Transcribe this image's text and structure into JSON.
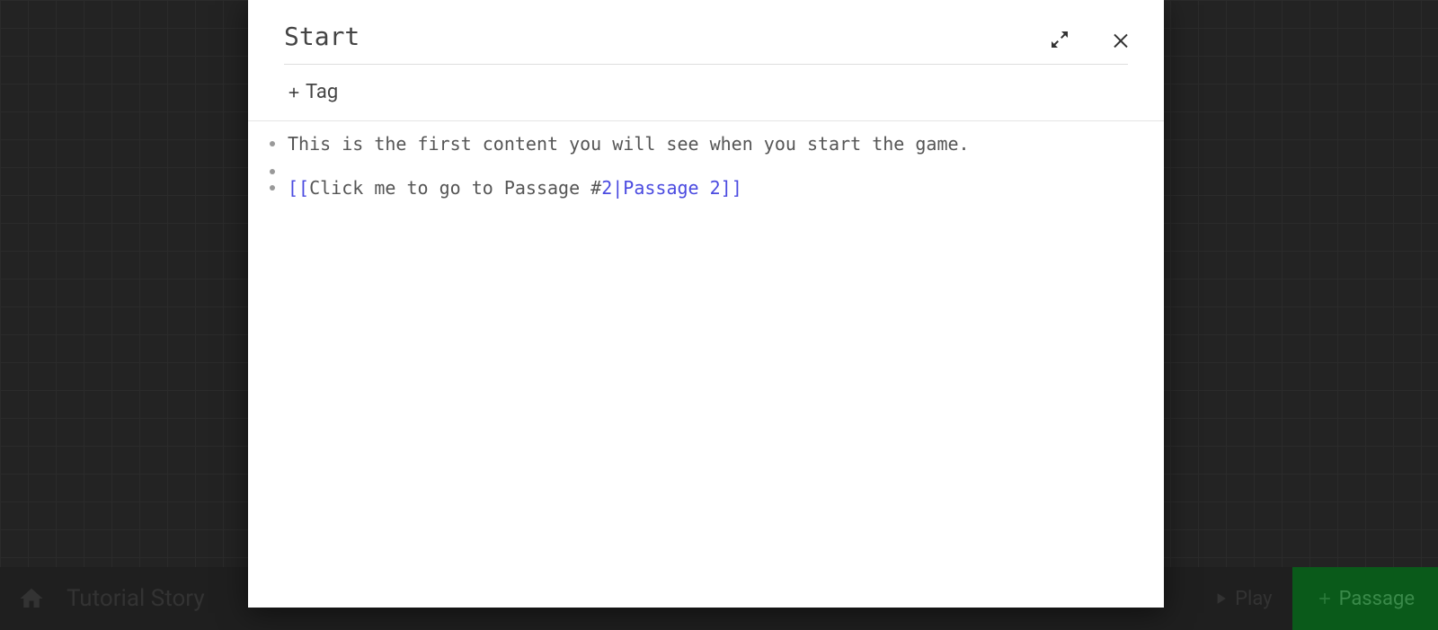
{
  "modal": {
    "title": "Start",
    "tag_button_label": "Tag",
    "lines": {
      "line1_plain": "This is the first content you will see when you start the game.",
      "line2_plain": "",
      "line3_open": "[[",
      "line3_text": "Click me to go to Passage #",
      "line3_link": "2|Passage 2]]"
    }
  },
  "bottom": {
    "story_name": "Tutorial Story",
    "play_label": "Play",
    "passage_label": "Passage"
  }
}
